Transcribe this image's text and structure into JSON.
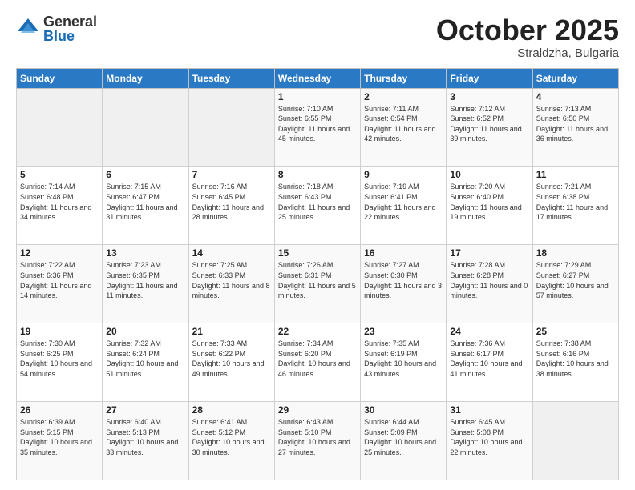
{
  "logo": {
    "general": "General",
    "blue": "Blue"
  },
  "header": {
    "month": "October 2025",
    "location": "Straldzha, Bulgaria"
  },
  "weekdays": [
    "Sunday",
    "Monday",
    "Tuesday",
    "Wednesday",
    "Thursday",
    "Friday",
    "Saturday"
  ],
  "weeks": [
    [
      {
        "day": "",
        "info": ""
      },
      {
        "day": "",
        "info": ""
      },
      {
        "day": "",
        "info": ""
      },
      {
        "day": "1",
        "info": "Sunrise: 7:10 AM\nSunset: 6:55 PM\nDaylight: 11 hours\nand 45 minutes."
      },
      {
        "day": "2",
        "info": "Sunrise: 7:11 AM\nSunset: 6:54 PM\nDaylight: 11 hours\nand 42 minutes."
      },
      {
        "day": "3",
        "info": "Sunrise: 7:12 AM\nSunset: 6:52 PM\nDaylight: 11 hours\nand 39 minutes."
      },
      {
        "day": "4",
        "info": "Sunrise: 7:13 AM\nSunset: 6:50 PM\nDaylight: 11 hours\nand 36 minutes."
      }
    ],
    [
      {
        "day": "5",
        "info": "Sunrise: 7:14 AM\nSunset: 6:48 PM\nDaylight: 11 hours\nand 34 minutes."
      },
      {
        "day": "6",
        "info": "Sunrise: 7:15 AM\nSunset: 6:47 PM\nDaylight: 11 hours\nand 31 minutes."
      },
      {
        "day": "7",
        "info": "Sunrise: 7:16 AM\nSunset: 6:45 PM\nDaylight: 11 hours\nand 28 minutes."
      },
      {
        "day": "8",
        "info": "Sunrise: 7:18 AM\nSunset: 6:43 PM\nDaylight: 11 hours\nand 25 minutes."
      },
      {
        "day": "9",
        "info": "Sunrise: 7:19 AM\nSunset: 6:41 PM\nDaylight: 11 hours\nand 22 minutes."
      },
      {
        "day": "10",
        "info": "Sunrise: 7:20 AM\nSunset: 6:40 PM\nDaylight: 11 hours\nand 19 minutes."
      },
      {
        "day": "11",
        "info": "Sunrise: 7:21 AM\nSunset: 6:38 PM\nDaylight: 11 hours\nand 17 minutes."
      }
    ],
    [
      {
        "day": "12",
        "info": "Sunrise: 7:22 AM\nSunset: 6:36 PM\nDaylight: 11 hours\nand 14 minutes."
      },
      {
        "day": "13",
        "info": "Sunrise: 7:23 AM\nSunset: 6:35 PM\nDaylight: 11 hours\nand 11 minutes."
      },
      {
        "day": "14",
        "info": "Sunrise: 7:25 AM\nSunset: 6:33 PM\nDaylight: 11 hours\nand 8 minutes."
      },
      {
        "day": "15",
        "info": "Sunrise: 7:26 AM\nSunset: 6:31 PM\nDaylight: 11 hours\nand 5 minutes."
      },
      {
        "day": "16",
        "info": "Sunrise: 7:27 AM\nSunset: 6:30 PM\nDaylight: 11 hours\nand 3 minutes."
      },
      {
        "day": "17",
        "info": "Sunrise: 7:28 AM\nSunset: 6:28 PM\nDaylight: 11 hours\nand 0 minutes."
      },
      {
        "day": "18",
        "info": "Sunrise: 7:29 AM\nSunset: 6:27 PM\nDaylight: 10 hours\nand 57 minutes."
      }
    ],
    [
      {
        "day": "19",
        "info": "Sunrise: 7:30 AM\nSunset: 6:25 PM\nDaylight: 10 hours\nand 54 minutes."
      },
      {
        "day": "20",
        "info": "Sunrise: 7:32 AM\nSunset: 6:24 PM\nDaylight: 10 hours\nand 51 minutes."
      },
      {
        "day": "21",
        "info": "Sunrise: 7:33 AM\nSunset: 6:22 PM\nDaylight: 10 hours\nand 49 minutes."
      },
      {
        "day": "22",
        "info": "Sunrise: 7:34 AM\nSunset: 6:20 PM\nDaylight: 10 hours\nand 46 minutes."
      },
      {
        "day": "23",
        "info": "Sunrise: 7:35 AM\nSunset: 6:19 PM\nDaylight: 10 hours\nand 43 minutes."
      },
      {
        "day": "24",
        "info": "Sunrise: 7:36 AM\nSunset: 6:17 PM\nDaylight: 10 hours\nand 41 minutes."
      },
      {
        "day": "25",
        "info": "Sunrise: 7:38 AM\nSunset: 6:16 PM\nDaylight: 10 hours\nand 38 minutes."
      }
    ],
    [
      {
        "day": "26",
        "info": "Sunrise: 6:39 AM\nSunset: 5:15 PM\nDaylight: 10 hours\nand 35 minutes."
      },
      {
        "day": "27",
        "info": "Sunrise: 6:40 AM\nSunset: 5:13 PM\nDaylight: 10 hours\nand 33 minutes."
      },
      {
        "day": "28",
        "info": "Sunrise: 6:41 AM\nSunset: 5:12 PM\nDaylight: 10 hours\nand 30 minutes."
      },
      {
        "day": "29",
        "info": "Sunrise: 6:43 AM\nSunset: 5:10 PM\nDaylight: 10 hours\nand 27 minutes."
      },
      {
        "day": "30",
        "info": "Sunrise: 6:44 AM\nSunset: 5:09 PM\nDaylight: 10 hours\nand 25 minutes."
      },
      {
        "day": "31",
        "info": "Sunrise: 6:45 AM\nSunset: 5:08 PM\nDaylight: 10 hours\nand 22 minutes."
      },
      {
        "day": "",
        "info": ""
      }
    ]
  ]
}
